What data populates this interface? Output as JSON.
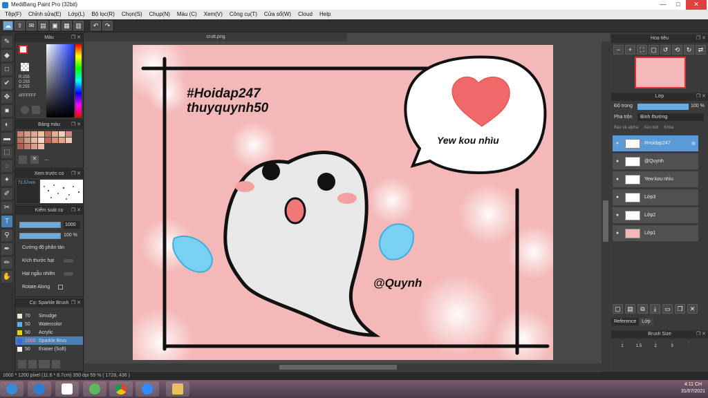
{
  "window": {
    "title": "MediBang Paint Pro (32bit)",
    "min": "—",
    "max": "□",
    "close": "✕"
  },
  "menu": [
    "Tệp(F)",
    "Chỉnh sửa(E)",
    "Lớp(L)",
    "Bộ lọc(R)",
    "Chọn(S)",
    "Chụp(N)",
    "Màu (C)",
    "Xem(V)",
    "Công cụ(T)",
    "Cửa sổ(W)",
    "Cloud",
    "Help"
  ],
  "color_panel": {
    "title": "Màu",
    "r": "R:255",
    "g": "G:255",
    "b": "B:255",
    "hex": "#FFFFFF"
  },
  "palette_panel": {
    "title": "Bảng màu",
    "more": "..."
  },
  "preview_panel": {
    "title": "Xem trước cọ",
    "size": "72.57mm"
  },
  "brush_control": {
    "title": "Kiểm soát cọ",
    "size_value": "1000",
    "opacity_value": "100 %",
    "labels": [
      "Cường độ phân tán",
      "Kích thước hạt",
      "Hạt ngẫu nhiên",
      "Rotate Along"
    ]
  },
  "brush_list": {
    "title": "Cọ: Sparkle Brush",
    "items": [
      {
        "num": "70",
        "name": "Smudge",
        "color": "#f0e6d0"
      },
      {
        "num": "50",
        "name": "Watercolor",
        "color": "#5ab0e0"
      },
      {
        "num": "50",
        "name": "Acrylic",
        "color": "#e8d020"
      },
      {
        "num": "1000",
        "name": "Sparkle Brus",
        "color": "#3a6ad0"
      },
      {
        "num": "50",
        "name": "Eraser (Soft)",
        "color": "#ffffff"
      }
    ]
  },
  "document": {
    "tab": "crutt.png"
  },
  "artwork": {
    "line1": "#Hoidap247",
    "line2": "thuyquynh50",
    "bubble_text": "Yew kou nhìu",
    "signature": "@Quynh"
  },
  "navigator": {
    "title": "Hoa tiêu"
  },
  "layers_panel": {
    "title": "Lớp",
    "opacity_label": "Độ trong",
    "opacity_value": "100 %",
    "blend_label": "Pha trộn",
    "blend_value": "Bình thường",
    "protect_alpha": "Bảo vệ alpha",
    "clipping": "Xén bớt",
    "lock": "Khóa",
    "layers": [
      "#Hoidap247",
      "@Quynh",
      "Yew kou nhìu",
      "Lớp3",
      "Lớp2",
      "Lớp1"
    ]
  },
  "tabs": {
    "reference": "Reference",
    "layer": "Lớp"
  },
  "brush_size_panel": {
    "title": "Brush Size",
    "values": [
      "1",
      "1.5",
      "2",
      "3"
    ]
  },
  "status": {
    "text": "1600 * 1200 pixel  (11.6 * 8.7cm)  350 dpi  59 %  ( 1728, 436 )"
  },
  "taskbar": {
    "time": "4:11 CH",
    "date": "31/07/2021"
  },
  "accent": "#5a9bd5"
}
